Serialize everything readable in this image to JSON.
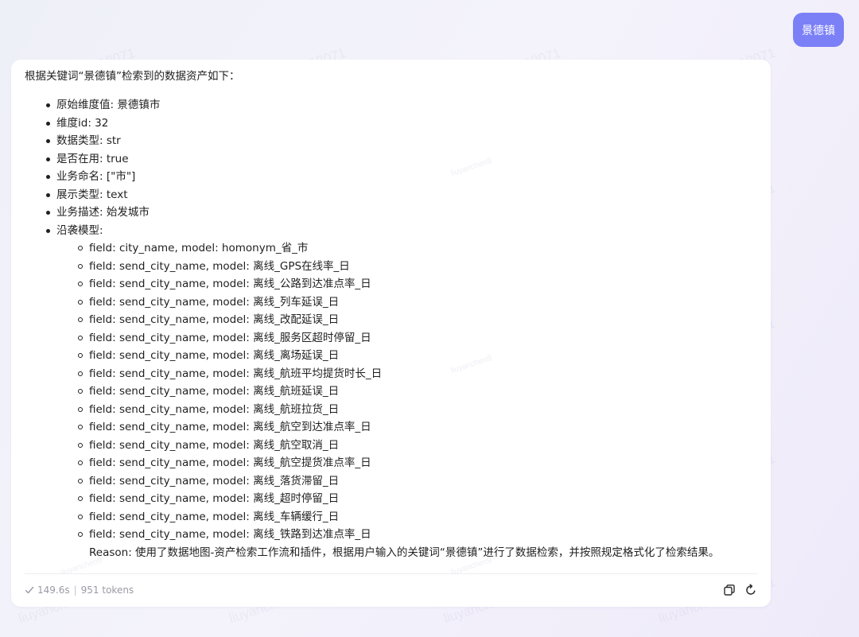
{
  "user_message": "景德镇",
  "answer": {
    "intro": "根据关键词“景德镇”检索到的数据资产如下：",
    "properties": [
      "原始维度值: 景德镇市",
      "维度id: 32",
      "数据类型: str",
      "是否在用: true",
      "业务命名: [\"市\"]",
      "展示类型: text",
      "业务描述: 始发城市",
      "沿袭模型:"
    ],
    "models": [
      "field: city_name, model: homonym_省_市",
      "field: send_city_name, model: 离线_GPS在线率_日",
      "field: send_city_name, model: 离线_公路到达准点率_日",
      "field: send_city_name, model: 离线_列车延误_日",
      "field: send_city_name, model: 离线_改配延误_日",
      "field: send_city_name, model: 离线_服务区超时停留_日",
      "field: send_city_name, model: 离线_离场延误_日",
      "field: send_city_name, model: 离线_航班平均提货时长_日",
      "field: send_city_name, model: 离线_航班延误_日",
      "field: send_city_name, model: 离线_航班拉货_日",
      "field: send_city_name, model: 离线_航空到达准点率_日",
      "field: send_city_name, model: 离线_航空取消_日",
      "field: send_city_name, model: 离线_航空提货准点率_日",
      "field: send_city_name, model: 离线_落货滞留_日",
      "field: send_city_name, model: 离线_超时停留_日",
      "field: send_city_name, model: 离线_车辆缓行_日",
      "field: send_city_name, model: 离线_铁路到达准点率_日"
    ],
    "reason": "Reason: 使用了数据地图-资产检索工作流和插件，根据用户输入的关键词“景德镇”进行了数据检索，并按照规定格式化了检索结果。"
  },
  "footer": {
    "duration": "149.6s",
    "separator": "|",
    "tokens": "951 tokens"
  },
  "watermark": {
    "text": "liuyanchen9-718071",
    "small_text": "liuyanchen9"
  },
  "colors": {
    "user_bubble": "#7b80f7",
    "card_background": "#ffffff",
    "muted_text": "#9a9aa6"
  },
  "icons": {
    "status": "check-icon",
    "copy": "copy-icon",
    "regenerate": "refresh-icon"
  }
}
